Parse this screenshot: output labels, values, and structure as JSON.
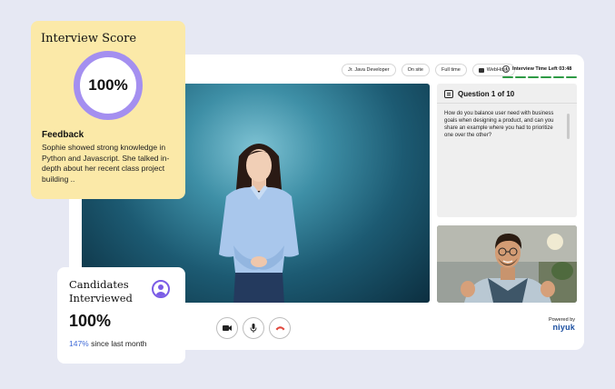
{
  "topbar": {
    "chips": [
      "Jr. Java Developer",
      "On site",
      "Full time",
      "WebHosy"
    ],
    "timer_label": "Interview Time Left 03:48",
    "progress_segments": 6
  },
  "question": {
    "title": "Question 1 of 10",
    "text": "How do you balance user need with business goals when designing a product, and can you share an example where you had to prioritize one over the other?"
  },
  "controls": {
    "icons": [
      "camera-icon",
      "mic-icon",
      "hang-up-icon"
    ]
  },
  "powered": {
    "label": "Powered by",
    "brand": "niyuk"
  },
  "score_card": {
    "title": "Interview Score",
    "score": "100%",
    "score_fraction": 1.0,
    "feedback_title": "Feedback",
    "feedback_text": "Sophie showed strong knowledge in Python and Javascript. She talked in-depth about her recent class project building .."
  },
  "candidates_card": {
    "title": "Candidates Interviewed",
    "value": "100%",
    "growth_pct": "147%",
    "growth_text": " since last month"
  },
  "colors": {
    "accent_purple": "#a48ff0",
    "score_card_bg": "#fbe9a8",
    "progress_green": "#2e9a45",
    "end_call_red": "#e0453a",
    "growth_blue": "#3f6ad8"
  }
}
